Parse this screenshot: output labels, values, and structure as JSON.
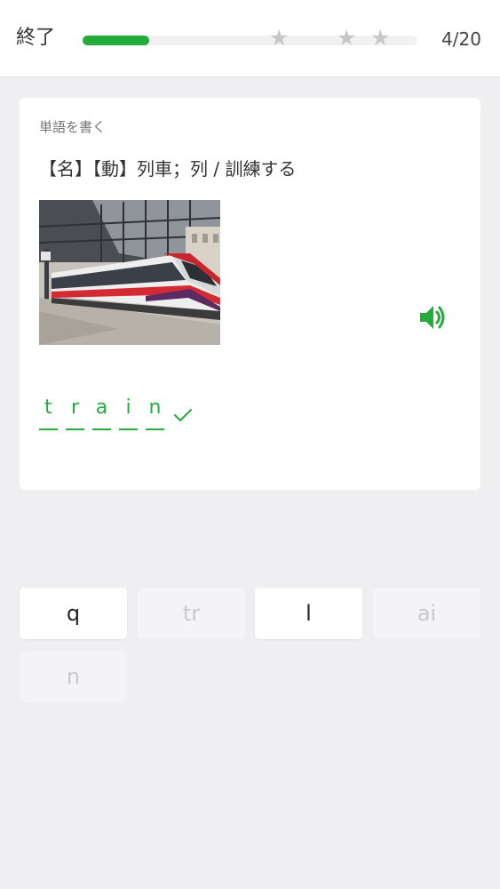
{
  "header": {
    "quit_label": "終了",
    "progress_fraction": 0.2,
    "counter": "4/20",
    "stars": [
      "star-icon",
      "star-icon",
      "star-icon"
    ]
  },
  "question": {
    "prompt_label": "単語を書く",
    "definition": "【名】【動】列車；列 / 訓練する",
    "image_alt": "train",
    "audio_icon": "speaker-icon"
  },
  "answer": {
    "letters": [
      "t",
      "r",
      "a",
      "i",
      "n"
    ],
    "status_icon": "check-icon"
  },
  "tiles": [
    {
      "label": "q",
      "state": "active"
    },
    {
      "label": "tr",
      "state": "used"
    },
    {
      "label": "l",
      "state": "active"
    },
    {
      "label": "ai",
      "state": "used"
    },
    {
      "label": "n",
      "state": "used"
    }
  ],
  "colors": {
    "accent": "#22ad3a",
    "background": "#efeef1",
    "card": "#ffffff",
    "tile_used": "#f4f4f6",
    "star_inactive": "#c7c7c7"
  }
}
